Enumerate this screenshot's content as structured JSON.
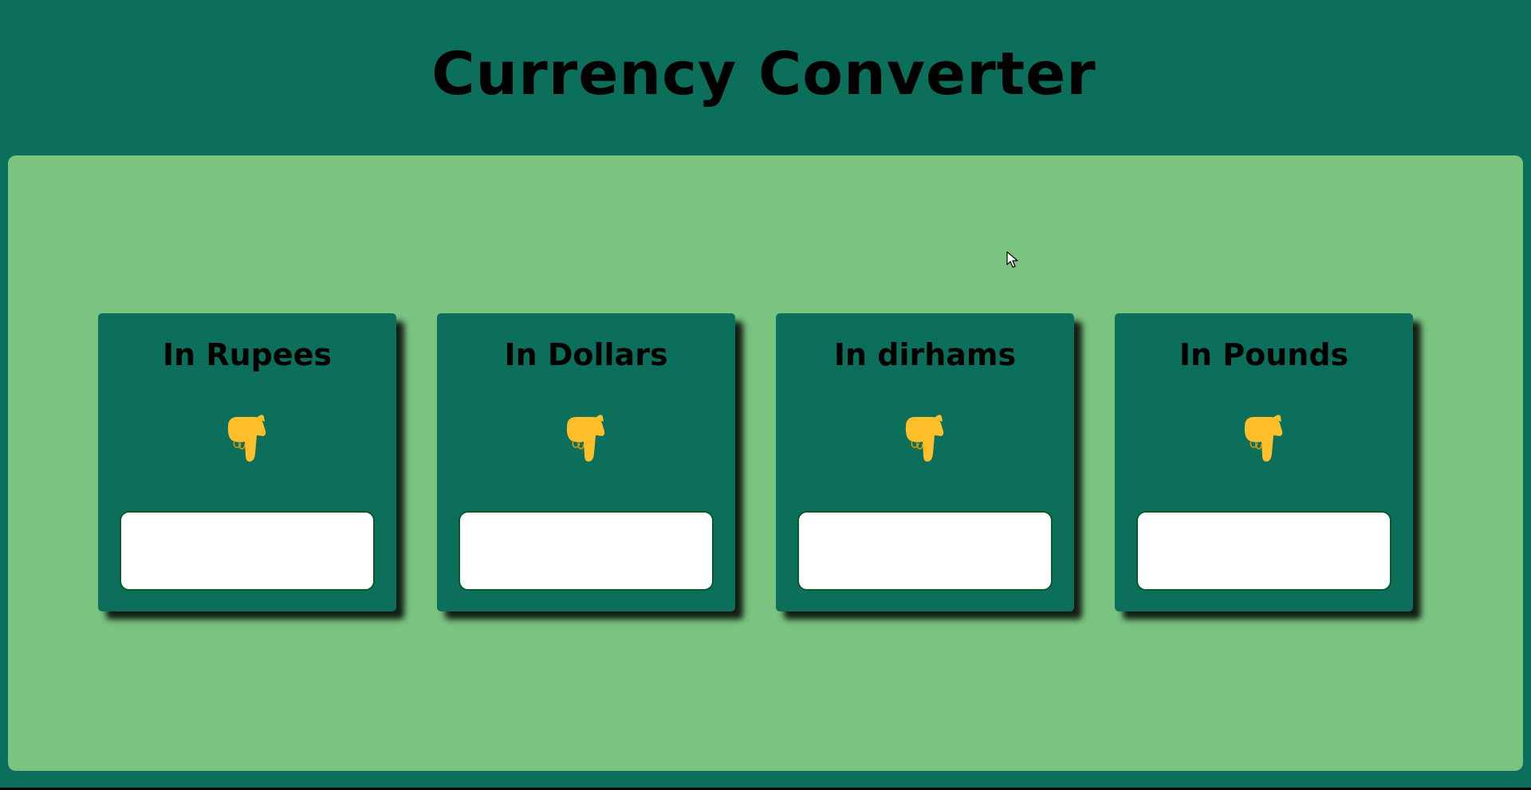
{
  "header": {
    "title": "Currency Converter"
  },
  "cards": [
    {
      "label": "In Rupees",
      "input_value": "",
      "icon": "backhand-index-pointing-down-icon"
    },
    {
      "label": "In Dollars",
      "input_value": "",
      "icon": "backhand-index-pointing-down-icon"
    },
    {
      "label": "In dirhams",
      "input_value": "",
      "icon": "backhand-index-pointing-down-icon"
    },
    {
      "label": "In Pounds",
      "input_value": "",
      "icon": "backhand-index-pointing-down-icon"
    }
  ],
  "colors": {
    "background": "#0b6f5b",
    "panel": "#7ac381",
    "card": "#0b6f5b",
    "icon": "#ffbf2a",
    "input_border": "#0a5a28"
  }
}
